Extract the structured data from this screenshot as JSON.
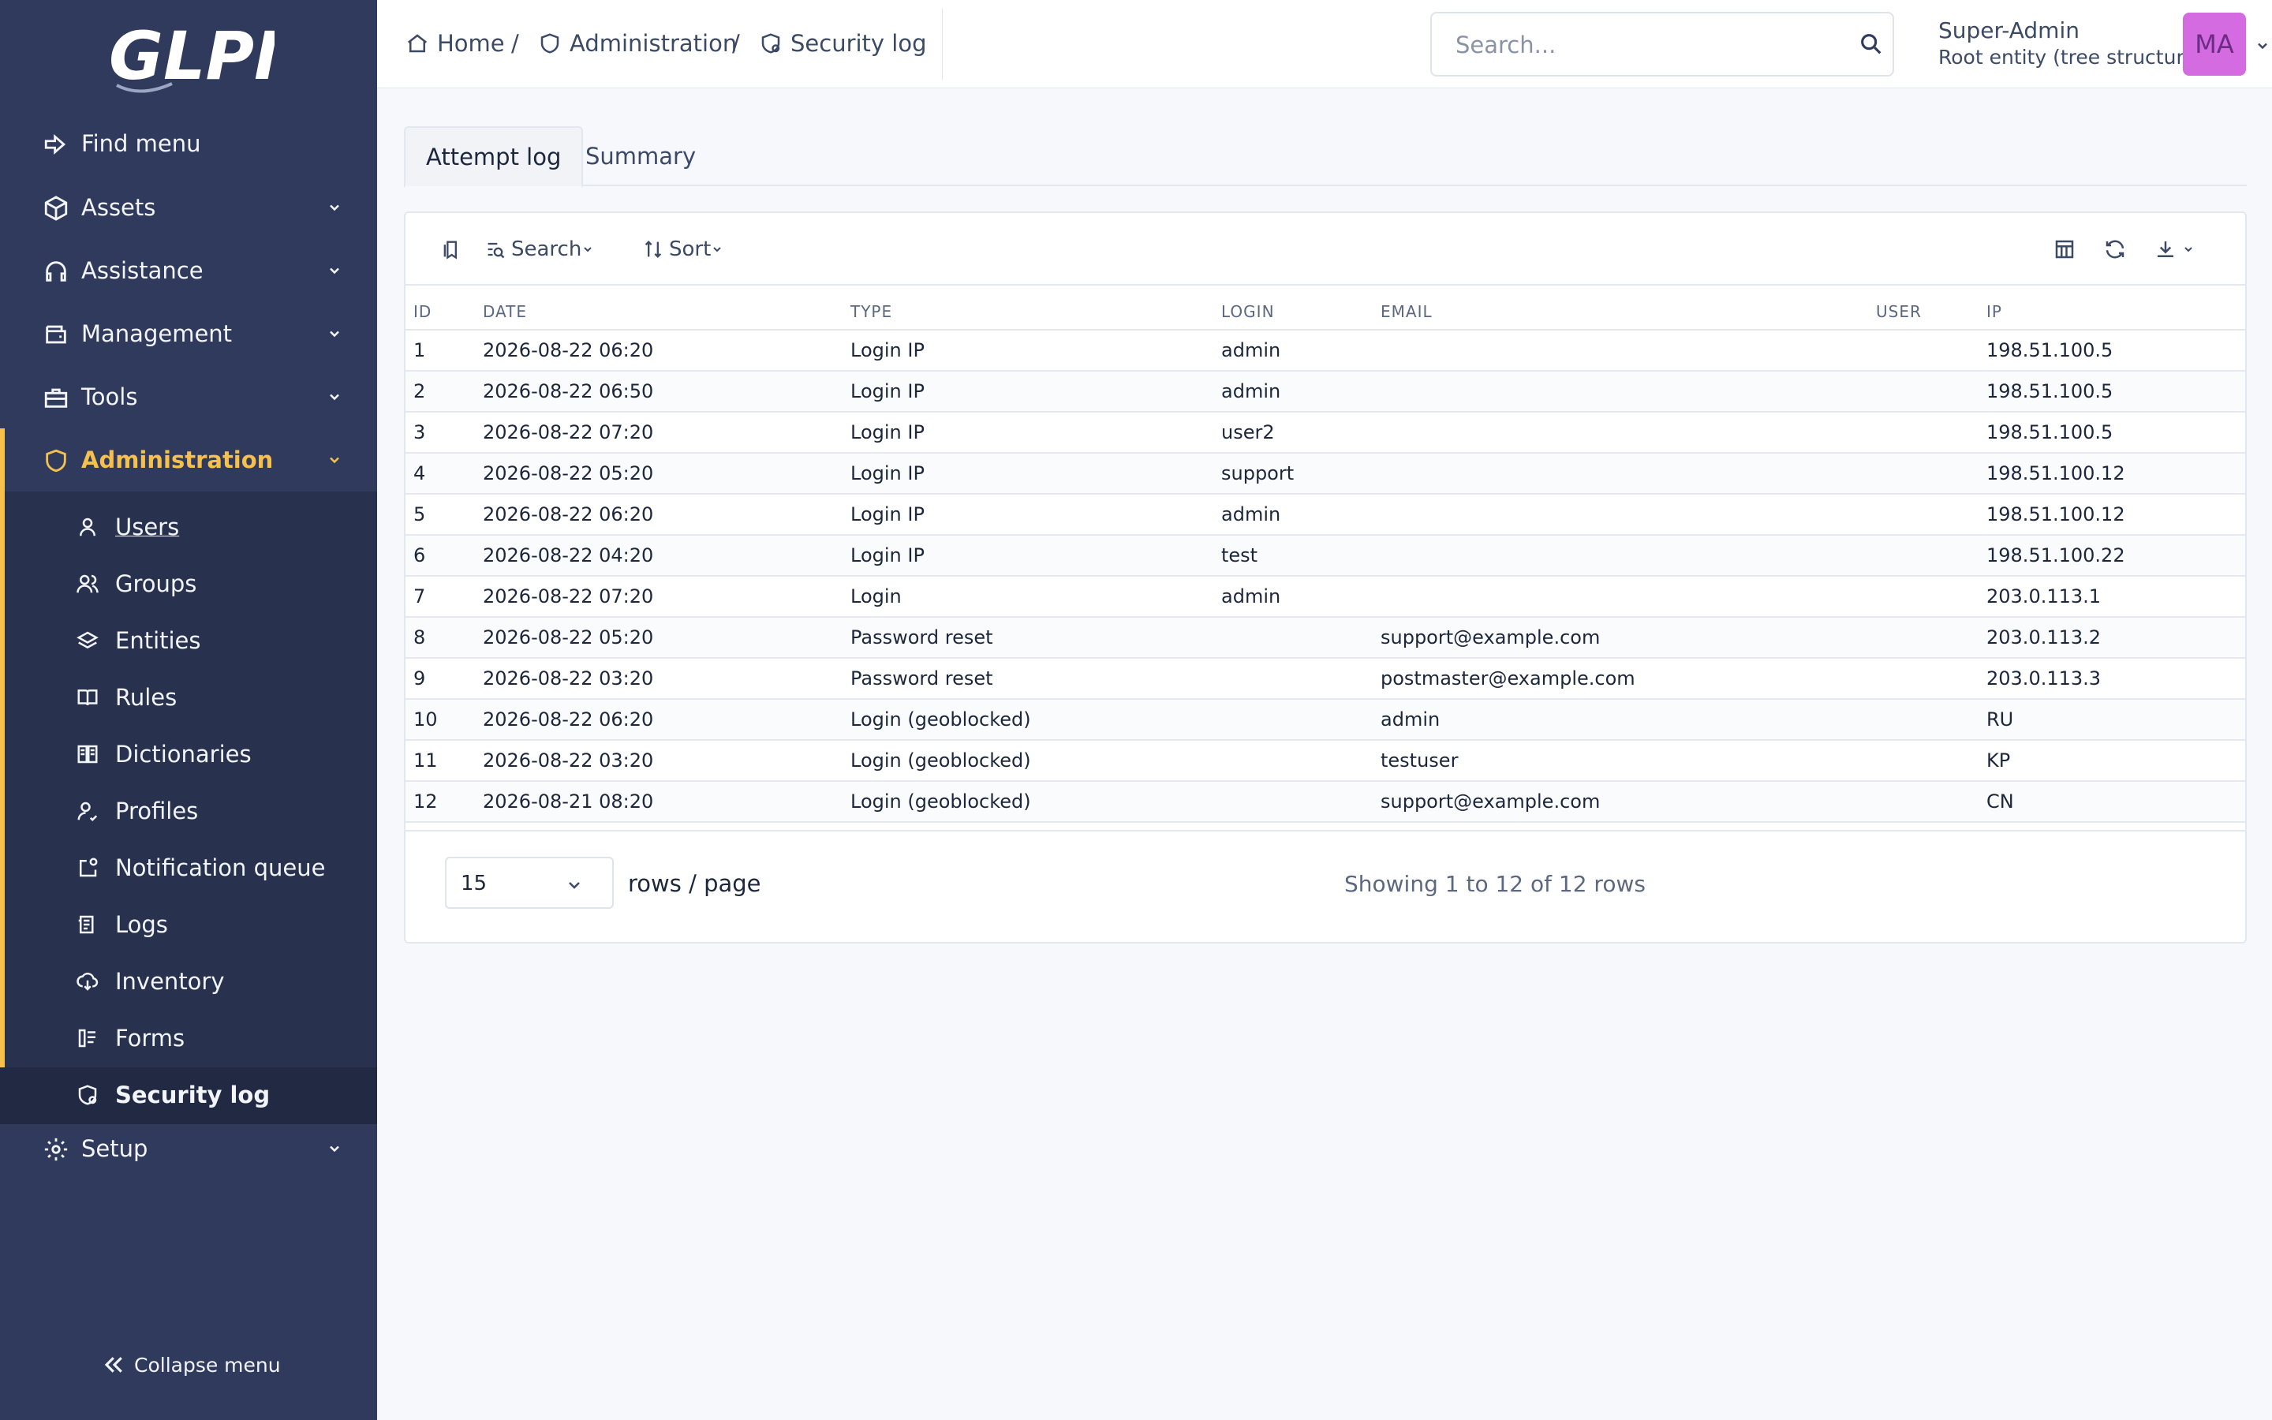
{
  "app": {
    "logo_text": "GLPI"
  },
  "sidebar": {
    "find_menu": "Find menu",
    "items": [
      {
        "label": "Assets",
        "icon": "box-icon"
      },
      {
        "label": "Assistance",
        "icon": "headset-icon"
      },
      {
        "label": "Management",
        "icon": "wallet-icon"
      },
      {
        "label": "Tools",
        "icon": "briefcase-icon"
      },
      {
        "label": "Administration",
        "icon": "shield-icon",
        "active": true
      },
      {
        "label": "Setup",
        "icon": "gear-icon"
      }
    ],
    "admin_sub": [
      {
        "label": "Users"
      },
      {
        "label": "Groups"
      },
      {
        "label": "Entities"
      },
      {
        "label": "Rules"
      },
      {
        "label": "Dictionaries"
      },
      {
        "label": "Profiles"
      },
      {
        "label": "Notification queue"
      },
      {
        "label": "Logs"
      },
      {
        "label": "Inventory"
      },
      {
        "label": "Forms"
      },
      {
        "label": "Security log",
        "current": true
      }
    ],
    "collapse_label": "Collapse menu",
    "accent_color": "#f6c04f",
    "bg_color": "#2f3a5d"
  },
  "breadcrumb": [
    {
      "label": "Home"
    },
    {
      "label": "Administration"
    },
    {
      "label": "Security log"
    }
  ],
  "search": {
    "placeholder": "Search...",
    "value": ""
  },
  "user": {
    "name": "Super-Admin",
    "entity": "Root entity (tree structure)",
    "initials": "MA",
    "avatar_color": "#d56be0"
  },
  "tabs": [
    {
      "label": "Attempt log",
      "active": true
    },
    {
      "label": "Summary"
    }
  ],
  "toolbar": {
    "search_label": "Search",
    "sort_label": "Sort"
  },
  "table": {
    "columns": [
      "ID",
      "DATE",
      "TYPE",
      "LOGIN",
      "EMAIL",
      "USER",
      "IP"
    ],
    "rows": [
      [
        "1",
        "2026-08-22 06:20",
        "Login IP",
        "admin",
        "",
        "",
        "198.51.100.5"
      ],
      [
        "2",
        "2026-08-22 06:50",
        "Login IP",
        "admin",
        "",
        "",
        "198.51.100.5"
      ],
      [
        "3",
        "2026-08-22 07:20",
        "Login IP",
        "user2",
        "",
        "",
        "198.51.100.5"
      ],
      [
        "4",
        "2026-08-22 05:20",
        "Login IP",
        "support",
        "",
        "",
        "198.51.100.12"
      ],
      [
        "5",
        "2026-08-22 06:20",
        "Login IP",
        "admin",
        "",
        "",
        "198.51.100.12"
      ],
      [
        "6",
        "2026-08-22 04:20",
        "Login IP",
        "test",
        "",
        "",
        "198.51.100.22"
      ],
      [
        "7",
        "2026-08-22 07:20",
        "Login",
        "admin",
        "",
        "",
        "203.0.113.1"
      ],
      [
        "8",
        "2026-08-22 05:20",
        "Password reset",
        "",
        "support@example.com",
        "",
        "203.0.113.2"
      ],
      [
        "9",
        "2026-08-22 03:20",
        "Password reset",
        "",
        "postmaster@example.com",
        "",
        "203.0.113.3"
      ],
      [
        "10",
        "2026-08-22 06:20",
        "Login (geoblocked)",
        "",
        "admin",
        "",
        "RU"
      ],
      [
        "11",
        "2026-08-22 03:20",
        "Login (geoblocked)",
        "",
        "testuser",
        "",
        "KP"
      ],
      [
        "12",
        "2026-08-21 08:20",
        "Login (geoblocked)",
        "",
        "support@example.com",
        "",
        "CN"
      ]
    ]
  },
  "pagination": {
    "page_size": "15",
    "rows_label": "rows / page",
    "showing": "Showing 1 to 12 of 12 rows"
  }
}
